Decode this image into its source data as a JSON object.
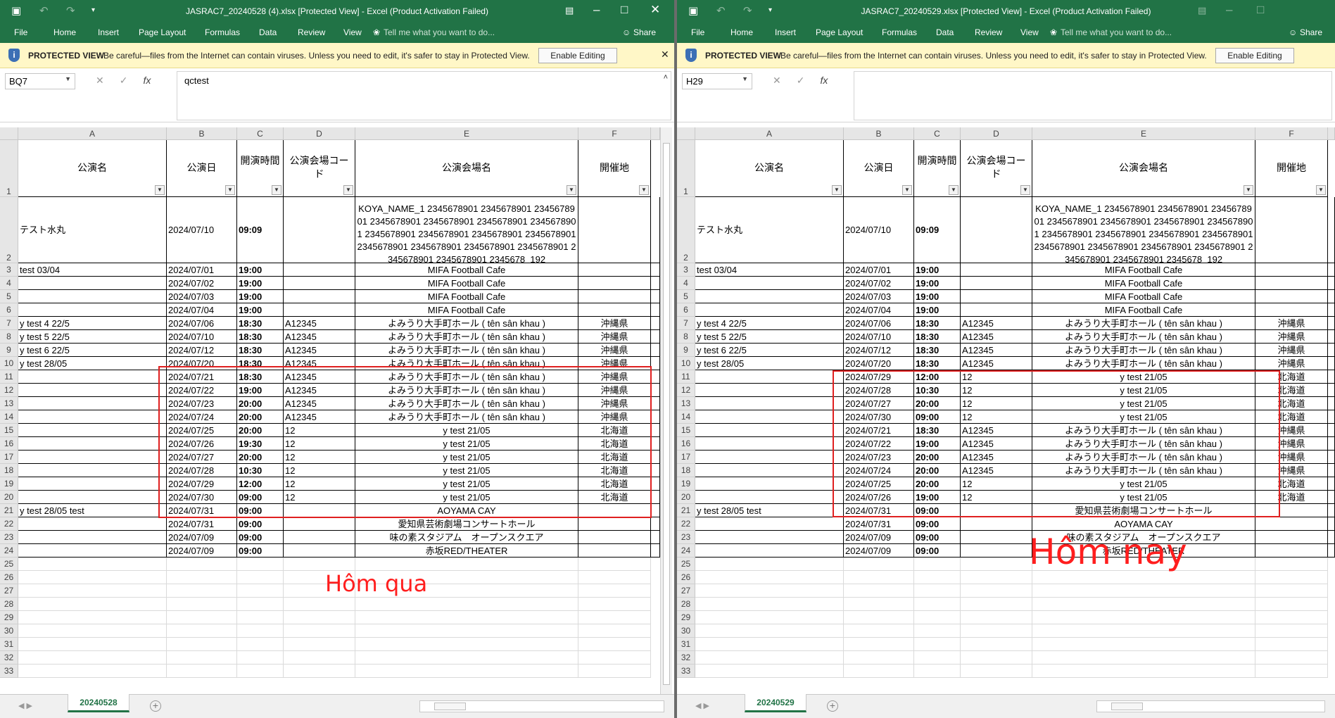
{
  "left": {
    "title": "JASRAC7_20240528 (4).xlsx  [Protected View] - Excel (Product Activation Failed)",
    "ribbon": [
      "File",
      "Home",
      "Insert",
      "Page Layout",
      "Formulas",
      "Data",
      "Review",
      "View"
    ],
    "tell_me": "Tell me what you want to do...",
    "share": "Share",
    "pv_label": "PROTECTED VIEW",
    "pv_msg": "Be careful—files from the Internet can contain viruses. Unless you need to edit, it's safer to stay in Protected View.",
    "enable_editing": "Enable Editing",
    "namebox": "BQ7",
    "formula": "qctest",
    "sheet_tab": "20240528",
    "note": "Hôm qua",
    "rows": [
      [
        "テスト水丸",
        "2024/07/10",
        "09:09",
        "",
        "KOYA_NAME_1 2345678901 2345678901 2345678901 2345678901 2345678901 2345678901 2345678901 2345678901 2345678901 2345678901 2345678901 2345678901 2345678901 2345678901 2345678901 2345678901 2345678901 2345678_192",
        ""
      ],
      [
        "test 03/04",
        "2024/07/01",
        "19:00",
        "",
        "MIFA Football Cafe",
        ""
      ],
      [
        "",
        "2024/07/02",
        "19:00",
        "",
        "MIFA Football Cafe",
        ""
      ],
      [
        "",
        "2024/07/03",
        "19:00",
        "",
        "MIFA Football Cafe",
        ""
      ],
      [
        "",
        "2024/07/04",
        "19:00",
        "",
        "MIFA Football Cafe",
        ""
      ],
      [
        "y test 4 22/5",
        "2024/07/06",
        "18:30",
        "A12345",
        "よみうり大手町ホール ( tên sân khau )",
        "沖縄県"
      ],
      [
        "y test 5 22/5",
        "2024/07/10",
        "18:30",
        "A12345",
        "よみうり大手町ホール ( tên sân khau )",
        "沖縄県"
      ],
      [
        "y test 6 22/5",
        "2024/07/12",
        "18:30",
        "A12345",
        "よみうり大手町ホール ( tên sân khau )",
        "沖縄県"
      ],
      [
        "y test 28/05",
        "2024/07/20",
        "18:30",
        "A12345",
        "よみうり大手町ホール ( tên sân khau )",
        "沖縄県"
      ],
      [
        "",
        "2024/07/21",
        "18:30",
        "A12345",
        "よみうり大手町ホール ( tên sân khau )",
        "沖縄県"
      ],
      [
        "",
        "2024/07/22",
        "19:00",
        "A12345",
        "よみうり大手町ホール ( tên sân khau )",
        "沖縄県"
      ],
      [
        "",
        "2024/07/23",
        "20:00",
        "A12345",
        "よみうり大手町ホール ( tên sân khau )",
        "沖縄県"
      ],
      [
        "",
        "2024/07/24",
        "20:00",
        "A12345",
        "よみうり大手町ホール ( tên sân khau )",
        "沖縄県"
      ],
      [
        "",
        "2024/07/25",
        "20:00",
        "12",
        "y test 21/05",
        "北海道"
      ],
      [
        "",
        "2024/07/26",
        "19:30",
        "12",
        "y test 21/05",
        "北海道"
      ],
      [
        "",
        "2024/07/27",
        "20:00",
        "12",
        "y test 21/05",
        "北海道"
      ],
      [
        "",
        "2024/07/28",
        "10:30",
        "12",
        "y test 21/05",
        "北海道"
      ],
      [
        "",
        "2024/07/29",
        "12:00",
        "12",
        "y test 21/05",
        "北海道"
      ],
      [
        "",
        "2024/07/30",
        "09:00",
        "12",
        "y test 21/05",
        "北海道"
      ],
      [
        "y test 28/05 test",
        "2024/07/31",
        "09:00",
        "",
        "AOYAMA CAY",
        ""
      ],
      [
        "",
        "2024/07/31",
        "09:00",
        "",
        "愛知県芸術劇場コンサートホール",
        ""
      ],
      [
        "",
        "2024/07/09",
        "09:00",
        "",
        "味の素スタジアム　オープンスクエア",
        ""
      ],
      [
        "",
        "2024/07/09",
        "09:00",
        "",
        "赤坂RED/THEATER",
        ""
      ]
    ]
  },
  "right": {
    "title": "JASRAC7_20240529.xlsx  [Protected View] - Excel (Product Activation Failed)",
    "ribbon": [
      "File",
      "Home",
      "Insert",
      "Page Layout",
      "Formulas",
      "Data",
      "Review",
      "View"
    ],
    "tell_me": "Tell me what you want to do...",
    "share": "Share",
    "pv_label": "PROTECTED VIEW",
    "pv_msg": "Be careful—files from the Internet can contain viruses. Unless you need to edit, it's safer to stay in Protected View.",
    "enable_editing": "Enable Editing",
    "namebox": "H29",
    "formula": "",
    "sheet_tab": "20240529",
    "note": "Hôm nay",
    "rows": [
      [
        "テスト水丸",
        "2024/07/10",
        "09:09",
        "",
        "KOYA_NAME_1 2345678901 2345678901 2345678901 2345678901 2345678901 2345678901 2345678901 2345678901 2345678901 2345678901 2345678901 2345678901 2345678901 2345678901 2345678901 2345678901 2345678901 2345678_192",
        ""
      ],
      [
        "test 03/04",
        "2024/07/01",
        "19:00",
        "",
        "MIFA Football Cafe",
        ""
      ],
      [
        "",
        "2024/07/02",
        "19:00",
        "",
        "MIFA Football Cafe",
        ""
      ],
      [
        "",
        "2024/07/03",
        "19:00",
        "",
        "MIFA Football Cafe",
        ""
      ],
      [
        "",
        "2024/07/04",
        "19:00",
        "",
        "MIFA Football Cafe",
        ""
      ],
      [
        "y test 4 22/5",
        "2024/07/06",
        "18:30",
        "A12345",
        "よみうり大手町ホール ( tên sân khau )",
        "沖縄県"
      ],
      [
        "y test 5 22/5",
        "2024/07/10",
        "18:30",
        "A12345",
        "よみうり大手町ホール ( tên sân khau )",
        "沖縄県"
      ],
      [
        "y test 6 22/5",
        "2024/07/12",
        "18:30",
        "A12345",
        "よみうり大手町ホール ( tên sân khau )",
        "沖縄県"
      ],
      [
        "y test 28/05",
        "2024/07/20",
        "18:30",
        "A12345",
        "よみうり大手町ホール ( tên sân khau )",
        "沖縄県"
      ],
      [
        "",
        "2024/07/29",
        "12:00",
        "12",
        "y test 21/05",
        "北海道"
      ],
      [
        "",
        "2024/07/28",
        "10:30",
        "12",
        "y test 21/05",
        "北海道"
      ],
      [
        "",
        "2024/07/27",
        "20:00",
        "12",
        "y test 21/05",
        "北海道"
      ],
      [
        "",
        "2024/07/30",
        "09:00",
        "12",
        "y test 21/05",
        "北海道"
      ],
      [
        "",
        "2024/07/21",
        "18:30",
        "A12345",
        "よみうり大手町ホール ( tên sân khau )",
        "沖縄県"
      ],
      [
        "",
        "2024/07/22",
        "19:00",
        "A12345",
        "よみうり大手町ホール ( tên sân khau )",
        "沖縄県"
      ],
      [
        "",
        "2024/07/23",
        "20:00",
        "A12345",
        "よみうり大手町ホール ( tên sân khau )",
        "沖縄県"
      ],
      [
        "",
        "2024/07/24",
        "20:00",
        "A12345",
        "よみうり大手町ホール ( tên sân khau )",
        "沖縄県"
      ],
      [
        "",
        "2024/07/25",
        "20:00",
        "12",
        "y test 21/05",
        "北海道"
      ],
      [
        "",
        "2024/07/26",
        "19:00",
        "12",
        "y test 21/05",
        "北海道"
      ],
      [
        "y test 28/05 test",
        "2024/07/31",
        "09:00",
        "",
        "愛知県芸術劇場コンサートホール",
        ""
      ],
      [
        "",
        "2024/07/31",
        "09:00",
        "",
        "AOYAMA CAY",
        ""
      ],
      [
        "",
        "2024/07/09",
        "09:00",
        "",
        "味の素スタジアム　オープンスクエア",
        ""
      ],
      [
        "",
        "2024/07/09",
        "09:00",
        "",
        "赤坂RED/THEATER",
        ""
      ]
    ]
  },
  "header": [
    "公演名",
    "公演日",
    "開演時間",
    "公演会場コード",
    "公演会場名",
    "開催地"
  ],
  "col_letters": [
    "A",
    "B",
    "C",
    "D",
    "E",
    "F"
  ],
  "sheet_nav": "◀  ▶",
  "colors": {
    "excel_green": "#217346",
    "pv_bar": "#fff7c7",
    "highlight": "#e02020"
  }
}
